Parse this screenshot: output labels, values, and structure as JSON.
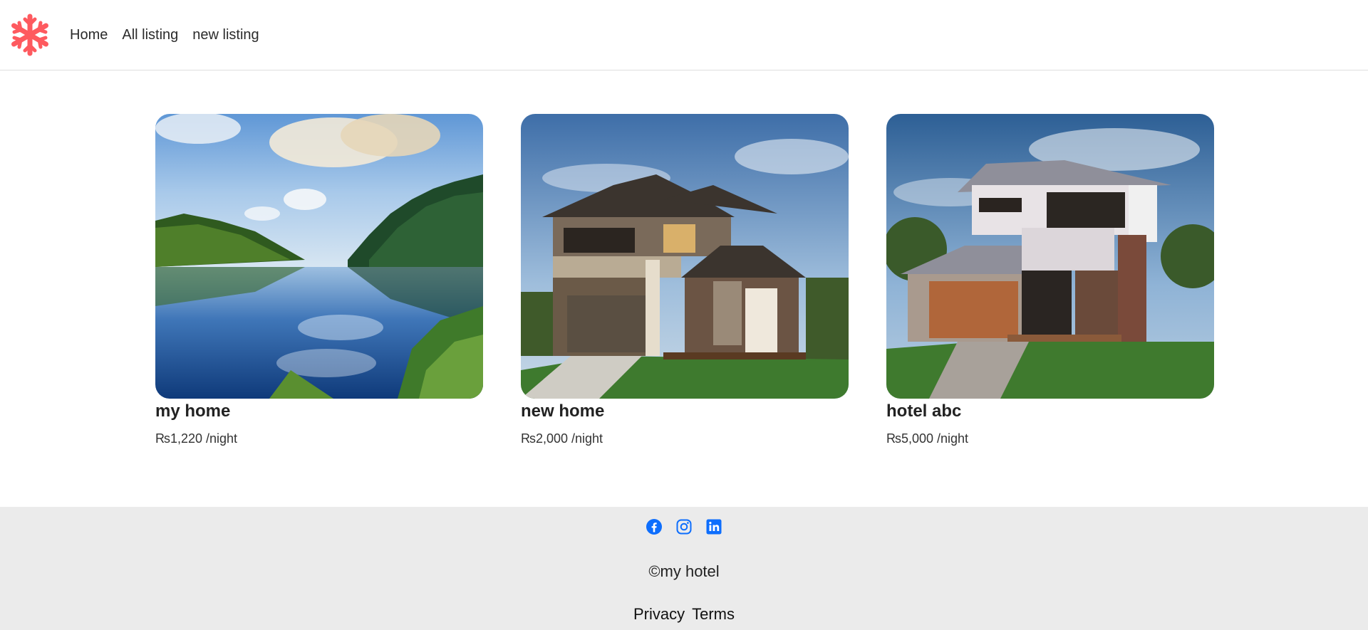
{
  "nav": {
    "logo_icon": "snowflake-icon",
    "brand_color": "#fe5a5f",
    "links": [
      {
        "label": "Home"
      },
      {
        "label": "All listing"
      },
      {
        "label": "new listing"
      }
    ]
  },
  "listings": [
    {
      "title": "my home",
      "price": "₨1,220 /night",
      "image": "lake-forest-photo"
    },
    {
      "title": "new home",
      "price": "₨2,000 /night",
      "image": "modern-house-photo"
    },
    {
      "title": "hotel abc",
      "price": "₨5,000 /night",
      "image": "two-storey-house-photo"
    }
  ],
  "footer": {
    "social_icons": [
      "facebook-icon",
      "instagram-icon",
      "linkedin-icon"
    ],
    "social_color": "#0d6efd",
    "copyright": "©my hotel",
    "links": [
      {
        "label": "Privacy"
      },
      {
        "label": "Terms"
      }
    ]
  }
}
